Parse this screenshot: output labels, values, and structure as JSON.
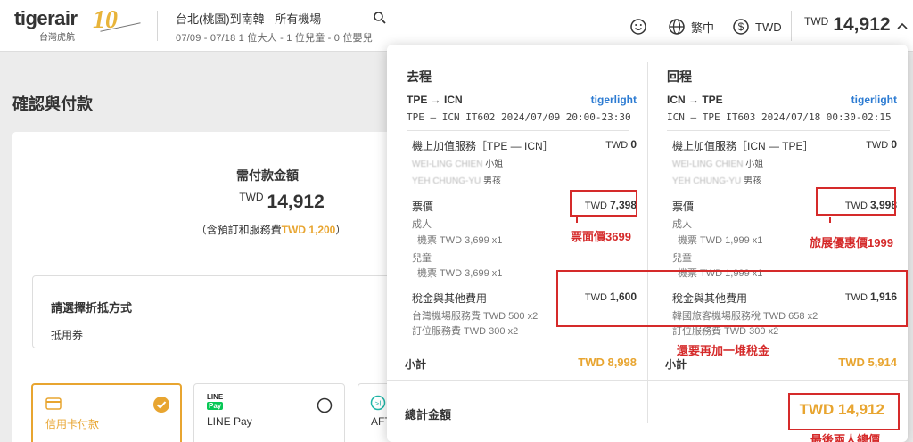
{
  "header": {
    "brand": "tigerair",
    "brand_sub": "台灣虎航",
    "anniversary": "10",
    "route": "台北(桃園)到南韓 - 所有機場",
    "trip_sub": "07/09 - 07/18  1 位大人 - 1 位兒童 - 0 位嬰兒",
    "language": "繁中",
    "currency": "TWD",
    "total_currency": "TWD",
    "total_amount": "14,912"
  },
  "page": {
    "title": "確認與付款",
    "due_label": "需付款金額",
    "due_currency": "TWD",
    "due_amount": "14,912",
    "due_note_prefix": "（含預訂和服務費",
    "due_note_fee": "TWD 1,200",
    "due_note_suffix": "）",
    "discount_title": "請選擇折抵方式",
    "discount_sub": "抵用券",
    "payments": [
      {
        "label": "信用卡付款",
        "selected": true
      },
      {
        "label": "LINE Pay",
        "badge_top": "LINE",
        "badge_bottom": "Pay",
        "selected": false
      },
      {
        "label": "AFT"
      }
    ]
  },
  "panel": {
    "outbound": {
      "title": "去程",
      "route": "TPE → ICN",
      "brand": "tigerlight",
      "detail": "TPE — ICN  IT602 2024/07/09 20:00-23:30",
      "addon_label": "機上加值服務［TPE — ICN］",
      "addon_cur": "TWD",
      "addon_val": "0",
      "passenger1": "WEI-LING CHIEN",
      "passenger1_title": "小姐",
      "passenger2": "YEH CHUNG-YU",
      "passenger2_title": "男孩",
      "fare_label": "票價",
      "fare_cur": "TWD",
      "fare_val": "7,398",
      "adult_label": "成人",
      "adult_detail": "機票 TWD 3,699 x1",
      "child_label": "兒童",
      "child_detail": "機票 TWD 3,699 x1",
      "tax_label": "稅金與其他費用",
      "tax_cur": "TWD",
      "tax_val": "1,600",
      "tax_detail1": "台灣機場服務費 TWD 500 x2",
      "tax_detail2": "訂位服務費 TWD 300 x2",
      "subtotal_label": "小計",
      "subtotal_val": "TWD 8,998"
    },
    "inbound": {
      "title": "回程",
      "route": "ICN → TPE",
      "brand": "tigerlight",
      "detail": "ICN — TPE  IT603 2024/07/18 00:30-02:15",
      "addon_label": "機上加值服務［ICN — TPE］",
      "addon_cur": "TWD",
      "addon_val": "0",
      "passenger1": "WEI-LING CHIEN",
      "passenger1_title": "小姐",
      "passenger2": "YEH CHUNG-YU",
      "passenger2_title": "男孩",
      "fare_label": "票價",
      "fare_cur": "TWD",
      "fare_val": "3,998",
      "adult_label": "成人",
      "adult_detail": "機票 TWD 1,999 x1",
      "child_label": "兒童",
      "child_detail": "機票 TWD 1,999 x1",
      "tax_label": "稅金與其他費用",
      "tax_cur": "TWD",
      "tax_val": "1,916",
      "tax_detail1": "韓國旅客機場服務稅 TWD 658 x2",
      "tax_detail2": "訂位服務費 TWD 300 x2",
      "subtotal_label": "小計",
      "subtotal_val": "TWD 5,914"
    },
    "grand_label": "總計金額",
    "grand_val": "TWD 14,912"
  },
  "annotations": {
    "note_fare_out": "票面價3699",
    "note_fare_in": "旅展優惠價1999",
    "note_tax": "還要再加一堆稅金",
    "note_total": "最後兩人總價"
  },
  "colors": {
    "brand_accent": "#e8a530",
    "tigerlight_blue": "#2c7bd2",
    "annotation_red": "#d52a2a"
  }
}
